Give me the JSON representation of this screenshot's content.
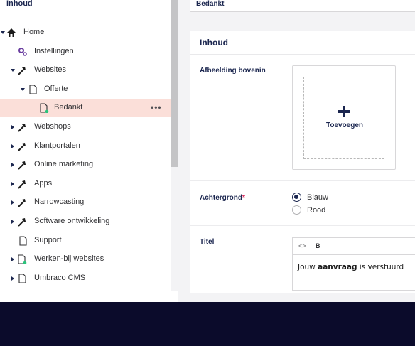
{
  "sidebar": {
    "title": "Inhoud",
    "items": [
      {
        "label": "Home"
      },
      {
        "label": "Instellingen"
      },
      {
        "label": "Websites"
      },
      {
        "label": "Offerte"
      },
      {
        "label": "Bedankt",
        "more": "•••"
      },
      {
        "label": "Webshops"
      },
      {
        "label": "Klantportalen"
      },
      {
        "label": "Online marketing"
      },
      {
        "label": "Apps"
      },
      {
        "label": "Narrowcasting"
      },
      {
        "label": "Software ontwikkeling"
      },
      {
        "label": "Support"
      },
      {
        "label": "Werken-bij websites"
      },
      {
        "label": "Umbraco CMS"
      }
    ]
  },
  "header": {
    "node_name": "Bedankt"
  },
  "panel": {
    "title": "Inhoud",
    "media": {
      "label": "Afbeelding bovenin",
      "add_label": "Toevoegen"
    },
    "background": {
      "label": "Achtergrond",
      "required_mark": "*",
      "options": [
        "Blauw",
        "Rood"
      ],
      "selected": "Blauw"
    },
    "title_field": {
      "label": "Titel",
      "toolbar": {
        "source": "<>",
        "bold": "B"
      },
      "text_before": "Jouw ",
      "text_bold": "aanvraag",
      "text_after": " is verstuurd"
    }
  },
  "colors": {
    "brand": "#1b264f",
    "selected_row": "#fbdfd9",
    "required": "#d42054",
    "footer": "#0b0b2b"
  }
}
